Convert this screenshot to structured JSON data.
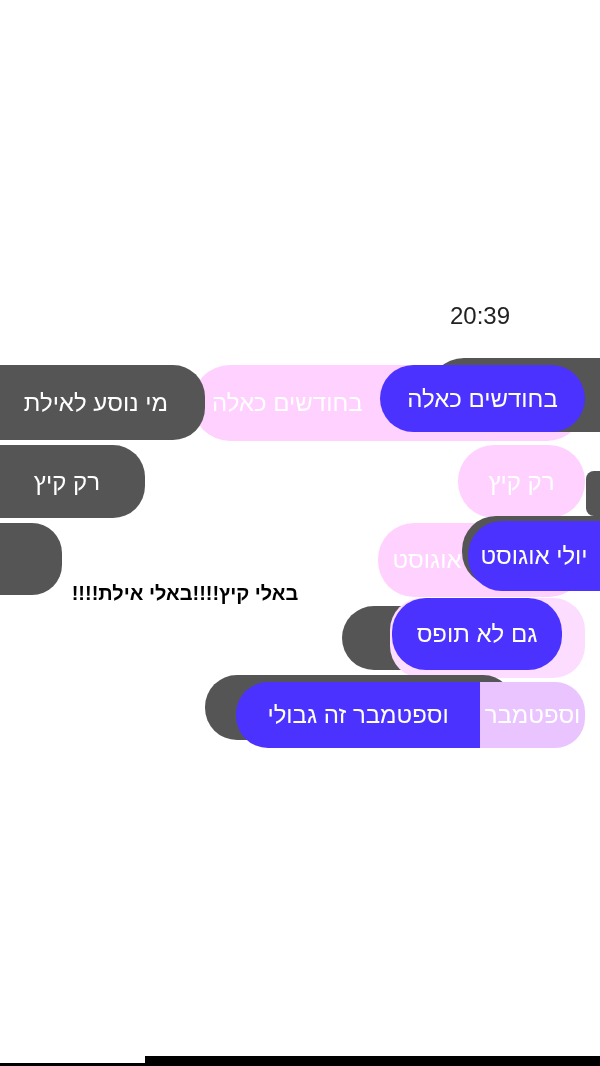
{
  "timestamp": "20:39",
  "rows": [
    {
      "bubbles": [
        {
          "color": "#ffd1ff"
        },
        {
          "color": "#555555"
        },
        {
          "color": "#555555"
        },
        {
          "color": "#4b32ff"
        }
      ],
      "texts": [
        "מי נוסע לאילת",
        "בחודשים כאלה",
        "בחודשים כאלה"
      ]
    },
    {
      "bubbles": [
        {
          "color": "#555555"
        },
        {
          "color": "#ffd1ff"
        },
        {
          "color": "#555555"
        }
      ],
      "texts": [
        "רק קיץ",
        "רק קיץ"
      ]
    },
    {
      "bubbles": [
        {
          "color": "#555555"
        },
        {
          "color": "#ffd1ff"
        },
        {
          "color": "#555555"
        },
        {
          "color": "#4b32ff"
        }
      ],
      "texts": [
        "אוגוסט",
        "יולי אוגוסט"
      ],
      "caption": "באלי קיץ!!!!באלי אילת!!!!"
    },
    {
      "bubbles": [
        {
          "color": "#555555"
        },
        {
          "color": "#fcdcff"
        },
        {
          "color": "#4b32ff"
        }
      ],
      "texts": [
        "גם לא תופס"
      ]
    },
    {
      "bubbles": [
        {
          "color": "#555555"
        },
        {
          "color": "#e9c4ff"
        },
        {
          "color": "#4b32ff"
        }
      ],
      "texts": [
        "וספטמבר זה גבולי",
        "וספטמבר"
      ]
    }
  ]
}
